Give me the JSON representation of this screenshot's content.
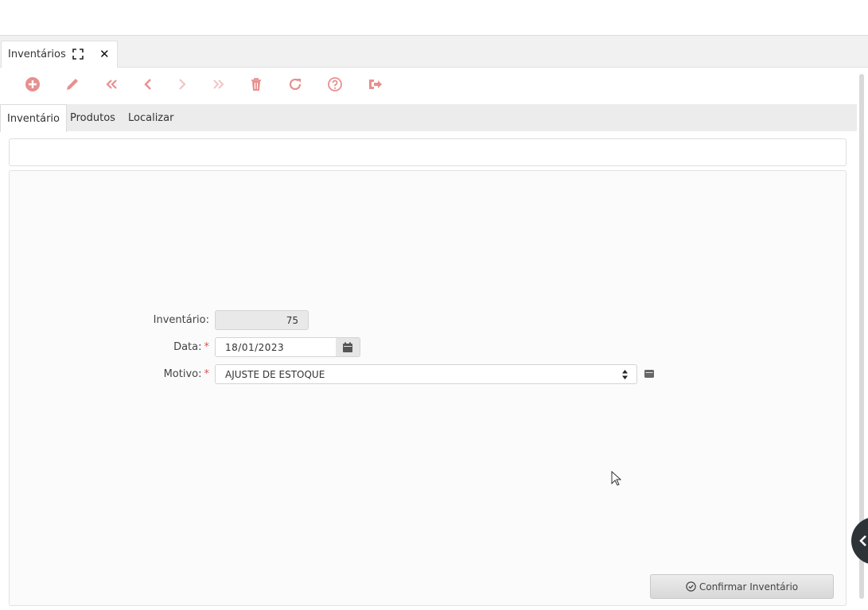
{
  "document_tab": {
    "label": "Inventários"
  },
  "toolbar": {
    "buttons": [
      "add",
      "edit",
      "first",
      "previous",
      "next",
      "last",
      "delete",
      "refresh",
      "help",
      "exit"
    ]
  },
  "subtabs": [
    {
      "label": "Inventário"
    },
    {
      "label": "Produtos"
    },
    {
      "label": "Localizar"
    }
  ],
  "form": {
    "inventario_label": "Inventário:",
    "inventario_value": "75",
    "data_label": "Data:",
    "data_value": "18/01/2023",
    "motivo_label": "Motivo:",
    "motivo_value": "AJUSTE DE ESTOQUE",
    "required_mark": "*"
  },
  "confirm_button": {
    "label": "Confirmar Inventário"
  },
  "colors": {
    "toolbar_icon": "#e88f8f",
    "toolbar_icon_disabled": "#f2c4c4",
    "required": "#d9534f"
  }
}
